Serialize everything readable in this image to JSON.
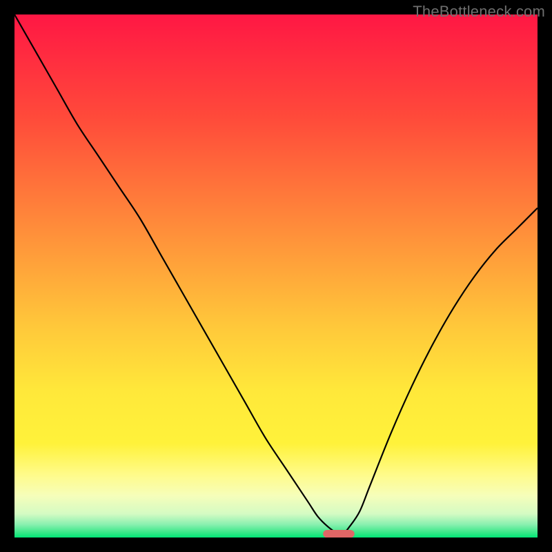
{
  "watermark": "TheBottleneck.com",
  "chart_data": {
    "type": "line",
    "title": "",
    "xlabel": "",
    "ylabel": "",
    "xlim": [
      0,
      100
    ],
    "ylim": [
      0,
      100
    ],
    "legend": false,
    "grid": false,
    "background_gradient": {
      "from_top_to_bottom": true,
      "stops": [
        {
          "offset": 0.0,
          "color": "#ff1744"
        },
        {
          "offset": 0.2,
          "color": "#ff4b3a"
        },
        {
          "offset": 0.4,
          "color": "#ff8a3a"
        },
        {
          "offset": 0.6,
          "color": "#ffc93a"
        },
        {
          "offset": 0.72,
          "color": "#ffe83a"
        },
        {
          "offset": 0.82,
          "color": "#fff23a"
        },
        {
          "offset": 0.88,
          "color": "#fffb8a"
        },
        {
          "offset": 0.92,
          "color": "#f6feba"
        },
        {
          "offset": 0.955,
          "color": "#d4fbc3"
        },
        {
          "offset": 0.975,
          "color": "#8af0b0"
        },
        {
          "offset": 0.99,
          "color": "#3be889"
        },
        {
          "offset": 1.0,
          "color": "#00e676"
        }
      ]
    },
    "series": [
      {
        "name": "bottleneck-curve",
        "color": "#000000",
        "x": [
          0,
          4,
          8,
          12,
          16,
          20,
          24,
          28,
          32,
          36,
          40,
          44,
          48,
          52,
          56,
          58,
          60,
          61.5,
          63,
          64,
          66,
          68,
          72,
          76,
          80,
          84,
          88,
          92,
          96,
          100
        ],
        "y": [
          100,
          93,
          86,
          79,
          73,
          67,
          61,
          54,
          47,
          40,
          33,
          26,
          19,
          13,
          7,
          4,
          2,
          1,
          1,
          2,
          5,
          10,
          20,
          29,
          37,
          44,
          50,
          55,
          59,
          63
        ]
      }
    ],
    "marker": {
      "name": "optimum-marker",
      "color": "#e06666",
      "x": 62,
      "y": 0.7,
      "width_x": 6,
      "height_y": 1.5
    }
  }
}
